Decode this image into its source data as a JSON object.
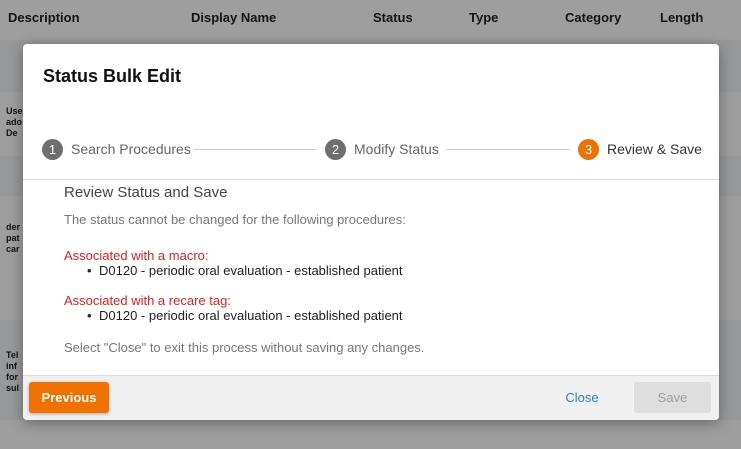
{
  "background_table": {
    "columns": [
      "Description",
      "Display Name",
      "Status",
      "Type",
      "Category",
      "Length"
    ],
    "rows": [
      [
        "Use",
        "ado",
        "De"
      ],
      [
        "der",
        "pat",
        "car"
      ],
      [
        "Tel",
        "inf",
        "for",
        "sul"
      ]
    ]
  },
  "modal": {
    "title": "Status Bulk Edit",
    "steps": [
      {
        "number": "1",
        "label": "Search Procedures"
      },
      {
        "number": "2",
        "label": "Modify Status"
      },
      {
        "number": "3",
        "label": "Review & Save"
      }
    ],
    "active_step": 3,
    "section_title": "Review Status and Save",
    "intro": "The status cannot be changed for the following procedures:",
    "groups": [
      {
        "title": "Associated with a macro:",
        "items": [
          "D0120 - periodic oral evaluation - established patient"
        ]
      },
      {
        "title": "Associated with a recare tag:",
        "items": [
          "D0120 - periodic oral evaluation - established patient"
        ]
      }
    ],
    "footnote": "Select \"Close\" to exit this process without saving any changes.",
    "buttons": {
      "previous": "Previous",
      "close": "Close",
      "save": "Save"
    }
  },
  "colors": {
    "accent": "#f07000",
    "link": "#2f7fd1",
    "warning_text": "#e0201f",
    "step_inactive": "#6e6e6e"
  }
}
